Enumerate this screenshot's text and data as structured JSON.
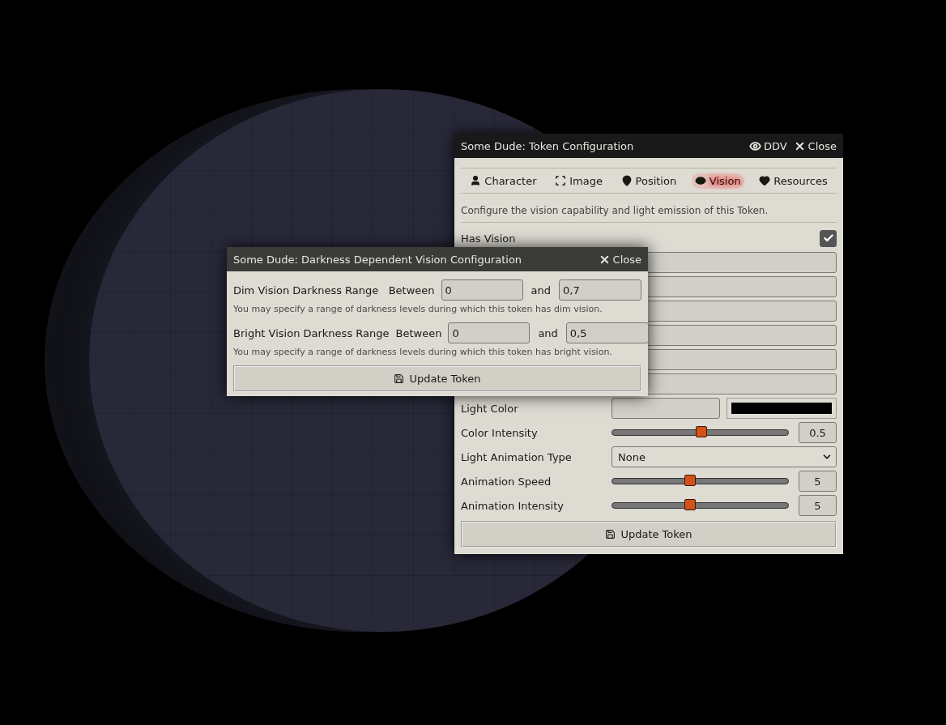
{
  "token_config": {
    "title": "Some Dude: Token Configuration",
    "header_buttons": [
      {
        "label": "DDV"
      },
      {
        "label": "Close"
      }
    ],
    "tabs": [
      {
        "label": "Character",
        "selected": false
      },
      {
        "label": "Image",
        "selected": false
      },
      {
        "label": "Position",
        "selected": false
      },
      {
        "label": "Vision",
        "selected": true
      },
      {
        "label": "Resources",
        "selected": false
      }
    ],
    "description": "Configure the vision capability and light emission of this Token.",
    "rows": [
      {
        "kind": "checkbox",
        "label": "Has Vision",
        "checked": true
      },
      {
        "kind": "input"
      },
      {
        "kind": "input"
      },
      {
        "kind": "input"
      },
      {
        "kind": "input"
      },
      {
        "kind": "input"
      },
      {
        "kind": "input"
      },
      {
        "kind": "color",
        "label": "Light Color"
      },
      {
        "kind": "slider",
        "label": "Color Intensity",
        "level": 0.5,
        "reading": "0.5"
      },
      {
        "kind": "select",
        "label": "Light Animation Type",
        "value": "None"
      },
      {
        "kind": "slider",
        "label": "Animation Speed",
        "level": 0.44,
        "reading": "5"
      },
      {
        "kind": "slider",
        "label": "Animation Intensity",
        "level": 0.44,
        "reading": "5"
      }
    ],
    "submit": "Update Token"
  },
  "ddv_config": {
    "title": "Some Dude: Darkness Dependent Vision Configuration",
    "close": "Close",
    "ranges": [
      {
        "label": "Dim Vision Darkness Range",
        "between": "Between",
        "from": "0",
        "and": "and",
        "to": "0,7",
        "hint": "You may specify a range of darkness levels during which this token has dim vision."
      },
      {
        "label": "Bright Vision Darkness Range",
        "between": "Between",
        "from": "0",
        "and": "and",
        "to": "0,5",
        "hint": "You may specify a range of darkness levels during which this token has bright vision."
      }
    ],
    "submit": "Update Token"
  }
}
